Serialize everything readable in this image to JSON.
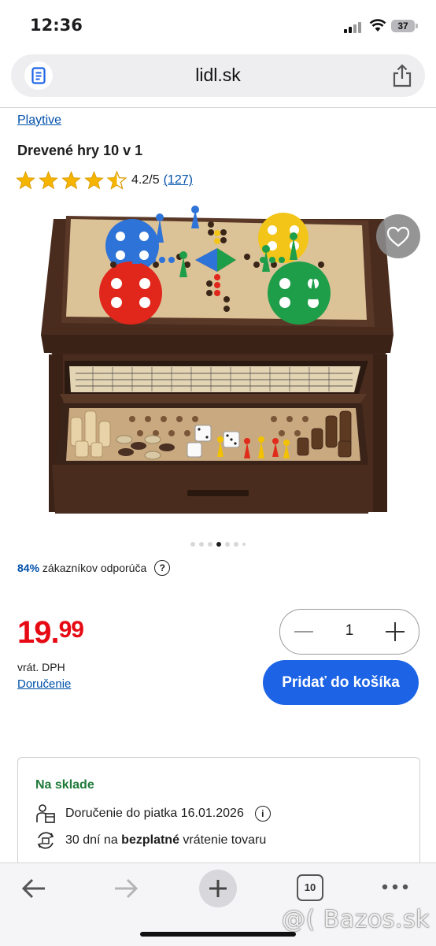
{
  "status_bar": {
    "time": "12:36",
    "battery": "37"
  },
  "browser": {
    "url": "lidl.sk"
  },
  "product": {
    "brand": "Playtive",
    "title": "Drevené hry 10 v 1",
    "rating": "4.2/5",
    "rating_count": "(127)",
    "stars": 4.2,
    "gallery_dots_total": 7,
    "gallery_active_index": 3,
    "recommend_percent": "84%",
    "recommend_text": "zákazníkov odporúča",
    "price": "19.",
    "price_cents": "99",
    "vat": "vrát. DPH",
    "delivery_link": "Doručenie",
    "quantity": "1",
    "add_to_cart": "Pridať do košíka"
  },
  "stock": {
    "status": "Na sklade",
    "delivery": "Doručenie do piatka 16.01.2026",
    "returns_prefix": "30 dní na ",
    "returns_bold": "bezplatné",
    "returns_suffix": " vrátenie tovaru"
  },
  "tab_bar": {
    "tab_count": "10"
  },
  "watermark": "@( Bazos.sk",
  "colors": {
    "accent": "#1c63e6",
    "price": "#e60a14",
    "link": "#0050aa",
    "stock": "#1f7a3a"
  }
}
